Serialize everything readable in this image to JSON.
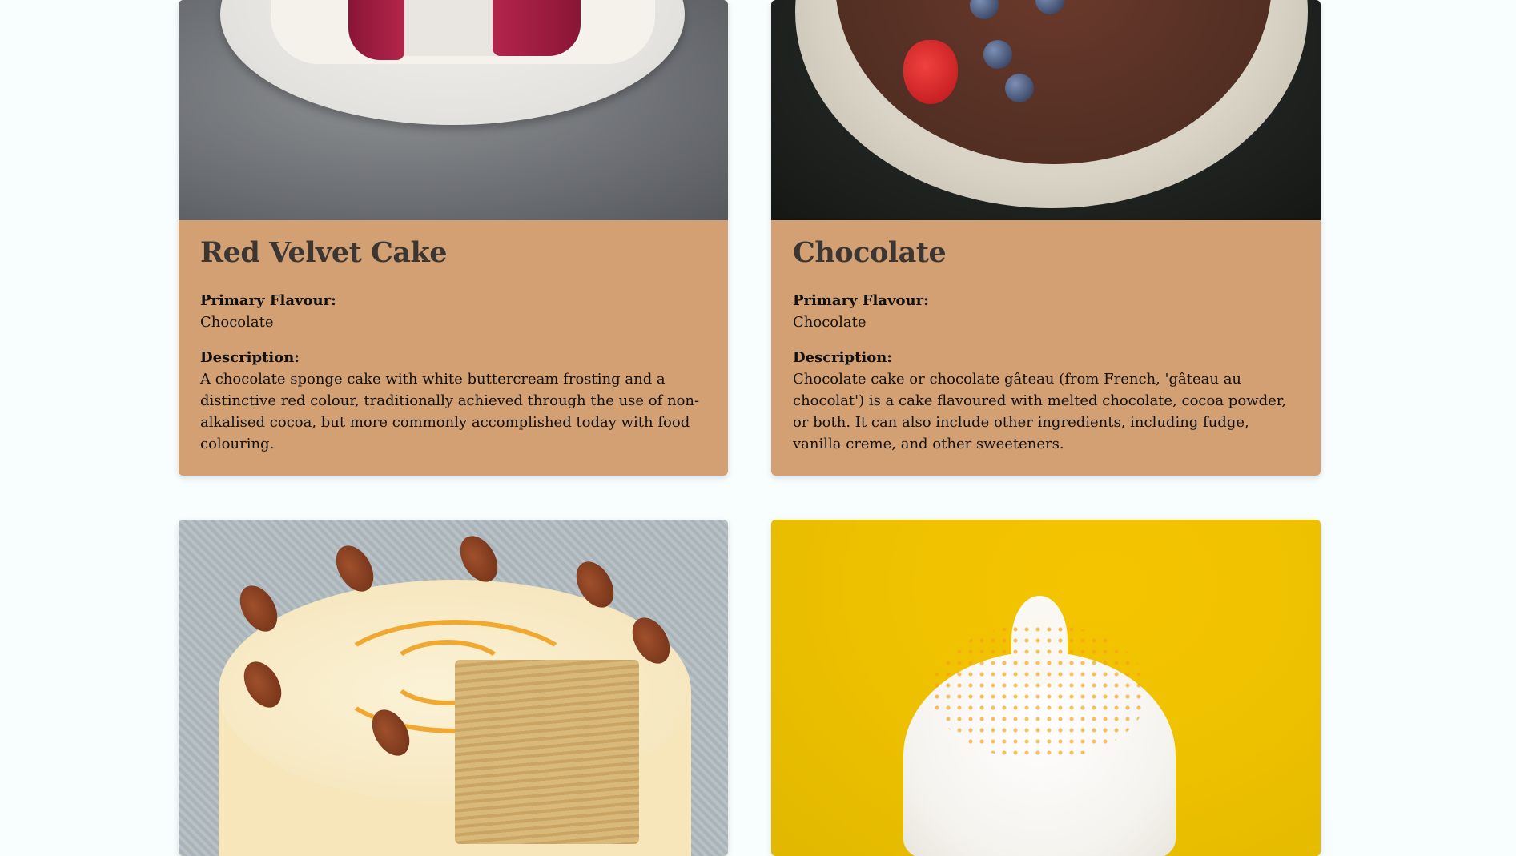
{
  "cards": [
    {
      "title": "Red Velvet Cake",
      "primary_flavour_label": "Primary Flavour:",
      "primary_flavour": "Chocolate",
      "description_label": "Description:",
      "description": "A chocolate sponge cake with white buttercream frosting and a distinctive red colour, traditionally achieved through the use of non-alkalised cocoa, but more commonly accomplished today with food colouring."
    },
    {
      "title": "Chocolate",
      "primary_flavour_label": "Primary Flavour:",
      "primary_flavour": "Chocolate",
      "description_label": "Description:",
      "description": "Chocolate cake or chocolate gâteau (from French, 'gâteau au chocolat') is a cake flavoured with melted chocolate, cocoa powder, or both. It can also include other ingredients, including fudge, vanilla creme, and other sweeteners."
    },
    {
      "title": "",
      "primary_flavour": "",
      "description": ""
    },
    {
      "title": "",
      "primary_flavour": "",
      "description": ""
    }
  ],
  "colors": {
    "card_body": "#d2a072",
    "page_background": "#f8fdfd",
    "title_text": "#3b3633"
  }
}
